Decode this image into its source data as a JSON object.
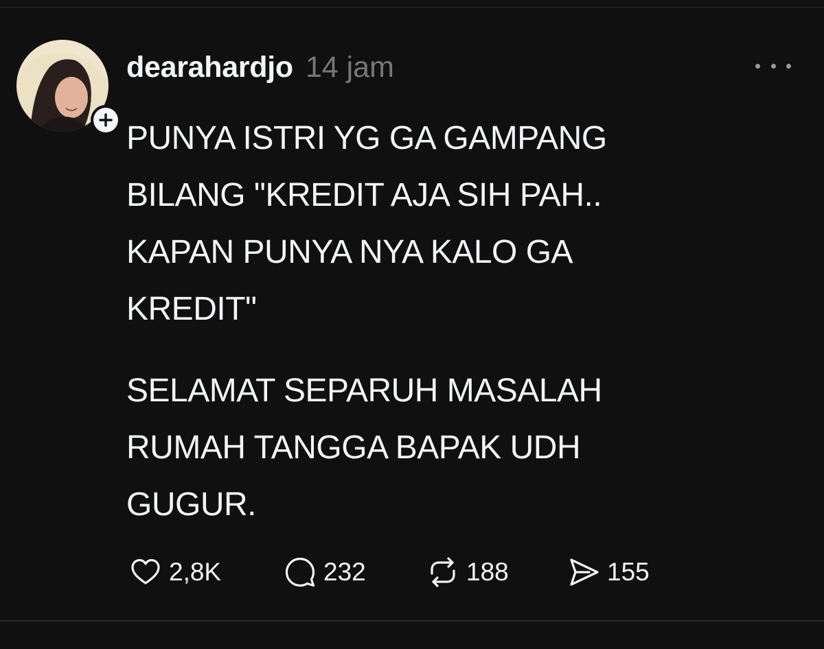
{
  "post": {
    "username": "dearahardjo",
    "timestamp": "14 jam",
    "paragraphs": [
      [
        "PUNYA ISTRI YG GA GAMPANG",
        "BILANG \"KREDIT AJA SIH PAH..",
        "KAPAN PUNYA NYA KALO GA",
        "KREDIT\""
      ],
      [
        "SELAMAT SEPARUH MASALAH",
        "RUMAH TANGGA BAPAK UDH",
        "GUGUR."
      ]
    ],
    "actions": {
      "likes": "2,8K",
      "replies": "232",
      "reposts": "188",
      "shares": "155"
    }
  },
  "icons": {
    "more": "more-horizontal-icon",
    "follow": "plus-icon",
    "like": "heart-icon",
    "reply": "speech-bubble-icon",
    "repost": "repost-icon",
    "share": "send-icon"
  },
  "colors": {
    "background": "#101010",
    "text": "#f3f5f7",
    "muted": "#777777"
  }
}
